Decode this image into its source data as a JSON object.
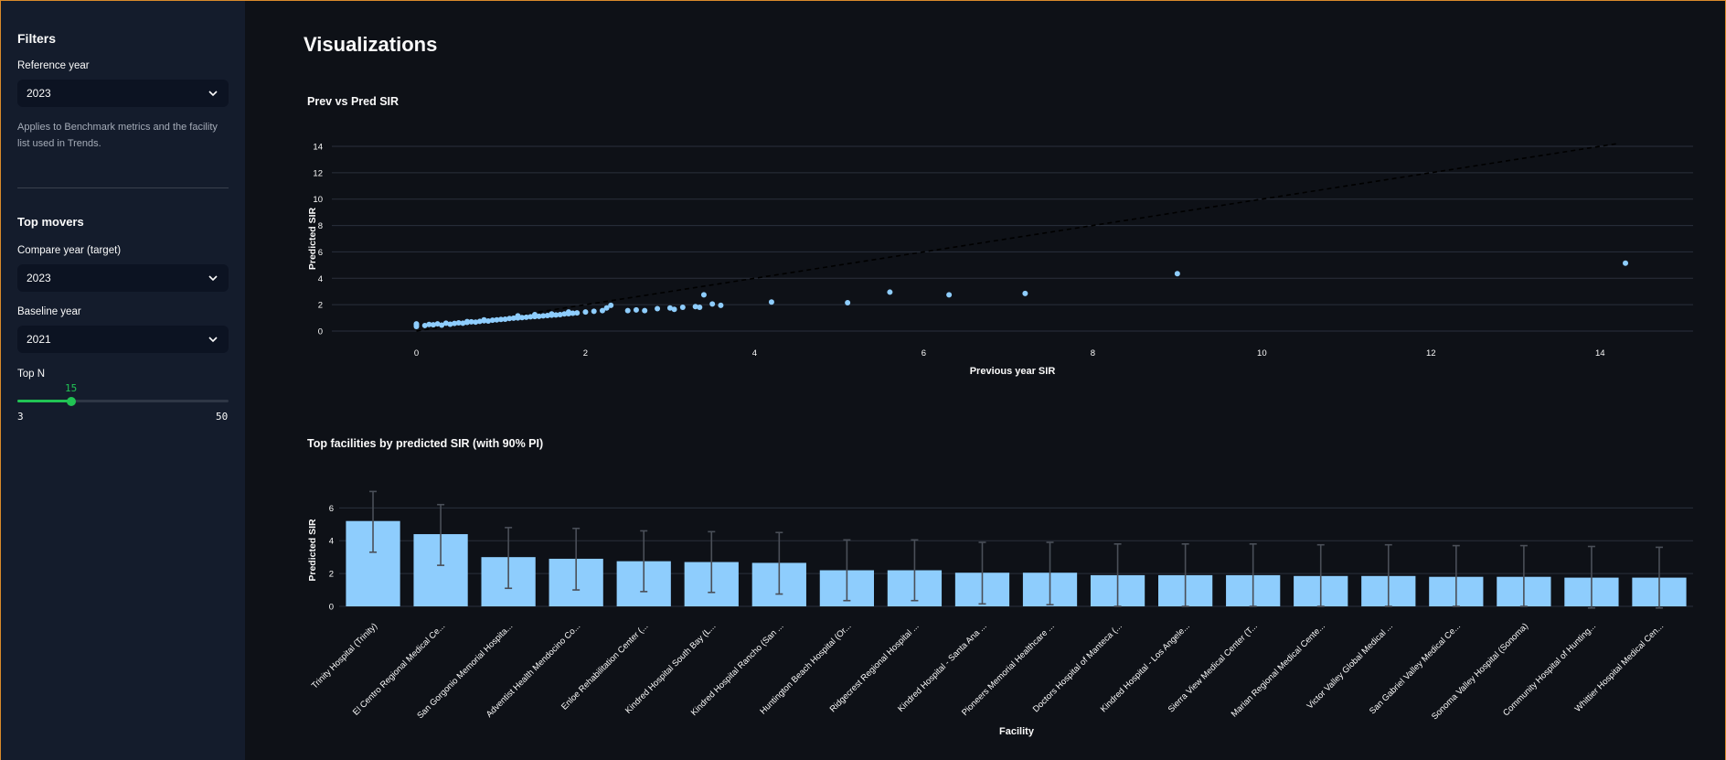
{
  "sidebar": {
    "filters_heading": "Filters",
    "reference_year_label": "Reference year",
    "reference_year_value": "2023",
    "note": "Applies to Benchmark metrics and the facility list used in Trends.",
    "top_movers_heading": "Top movers",
    "compare_year_label": "Compare year (target)",
    "compare_year_value": "2023",
    "baseline_year_label": "Baseline year",
    "baseline_year_value": "2021",
    "top_n_label": "Top N",
    "top_n_value": 15,
    "top_n_min": 3,
    "top_n_max": 50
  },
  "main": {
    "title": "Visualizations"
  },
  "colors": {
    "accent": "#21c354",
    "bar": "#8ecdfd",
    "point": "#8ecdfd",
    "background": "#0e1117",
    "sidebar": "#141c2c"
  },
  "icons": [
    "chevron-down-icon"
  ],
  "chart_data": [
    {
      "type": "scatter",
      "title": "Prev vs Pred SIR",
      "xlabel": "Previous year SIR",
      "ylabel": "Predicted SIR",
      "xlim": [
        -1,
        15.1
      ],
      "ylim": [
        0,
        14
      ],
      "xticks": [
        0,
        2,
        4,
        6,
        8,
        10,
        12,
        14
      ],
      "yticks": [
        0,
        2,
        4,
        6,
        8,
        10,
        12,
        14
      ],
      "grid": true,
      "reference_line": {
        "style": "dashed",
        "from": [
          0,
          0
        ],
        "to": [
          14.2,
          14.2
        ]
      },
      "points": [
        [
          0.0,
          0.35
        ],
        [
          0.0,
          0.45
        ],
        [
          0.0,
          0.55
        ],
        [
          0.1,
          0.42
        ],
        [
          0.15,
          0.5
        ],
        [
          0.2,
          0.48
        ],
        [
          0.25,
          0.55
        ],
        [
          0.3,
          0.45
        ],
        [
          0.35,
          0.6
        ],
        [
          0.4,
          0.52
        ],
        [
          0.45,
          0.58
        ],
        [
          0.5,
          0.62
        ],
        [
          0.55,
          0.6
        ],
        [
          0.6,
          0.66
        ],
        [
          0.65,
          0.7
        ],
        [
          0.7,
          0.68
        ],
        [
          0.75,
          0.74
        ],
        [
          0.8,
          0.78
        ],
        [
          0.85,
          0.76
        ],
        [
          0.9,
          0.82
        ],
        [
          0.95,
          0.85
        ],
        [
          1.0,
          0.88
        ],
        [
          1.05,
          0.9
        ],
        [
          1.1,
          0.95
        ],
        [
          1.15,
          0.98
        ],
        [
          1.2,
          1.0
        ],
        [
          1.25,
          1.02
        ],
        [
          1.3,
          1.05
        ],
        [
          1.35,
          1.08
        ],
        [
          1.4,
          1.1
        ],
        [
          1.45,
          1.12
        ],
        [
          1.5,
          1.15
        ],
        [
          1.55,
          1.18
        ],
        [
          1.6,
          1.2
        ],
        [
          1.65,
          1.22
        ],
        [
          1.7,
          1.25
        ],
        [
          1.75,
          1.3
        ],
        [
          1.8,
          1.32
        ],
        [
          1.85,
          1.35
        ],
        [
          1.9,
          1.38
        ],
        [
          1.2,
          1.15
        ],
        [
          1.4,
          1.25
        ],
        [
          1.6,
          1.3
        ],
        [
          1.8,
          1.45
        ],
        [
          0.6,
          0.72
        ],
        [
          0.8,
          0.85
        ],
        [
          2.0,
          1.45
        ],
        [
          2.1,
          1.5
        ],
        [
          2.2,
          1.55
        ],
        [
          2.25,
          1.75
        ],
        [
          2.3,
          1.95
        ],
        [
          2.5,
          1.55
        ],
        [
          2.6,
          1.6
        ],
        [
          2.7,
          1.55
        ],
        [
          2.85,
          1.7
        ],
        [
          3.0,
          1.75
        ],
        [
          3.05,
          1.65
        ],
        [
          3.15,
          1.8
        ],
        [
          3.3,
          1.85
        ],
        [
          3.35,
          1.8
        ],
        [
          3.4,
          2.75
        ],
        [
          3.5,
          2.05
        ],
        [
          3.6,
          1.95
        ],
        [
          4.2,
          2.2
        ],
        [
          5.1,
          2.15
        ],
        [
          5.6,
          2.95
        ],
        [
          6.3,
          2.75
        ],
        [
          7.2,
          2.85
        ],
        [
          9.0,
          4.35
        ],
        [
          14.3,
          5.15
        ]
      ]
    },
    {
      "type": "bar",
      "title": "Top facilities by predicted SIR (with 90% PI)",
      "xlabel": "Facility",
      "ylabel": "Predicted SIR",
      "ylim": [
        0,
        7.3
      ],
      "yticks": [
        0,
        2,
        4,
        6
      ],
      "grid": true,
      "categories": [
        "Trinity Hospital (Trinity)",
        "El Centro Regional Medical Ce...",
        "San Gorgonio Memorial Hospita...",
        "Adventist Health Mendocino Co...",
        "Enloe Rehabilitation Center (...",
        "Kindred Hospital South Bay (L...",
        "Kindred Hospital Rancho (San ...",
        "Huntington Beach Hospital (Or...",
        "Ridgecrest Regional Hospital ...",
        "Kindred Hospital - Santa Ana ...",
        "Pioneers Memorial Healthcare ...",
        "Doctors Hospital of Manteca (...",
        "Kindred Hospital - Los Angele...",
        "Sierra View Medical Center (T...",
        "Marian Regional Medical Cente...",
        "Victor Valley Global Medical ...",
        "San Gabriel Valley Medical Ce...",
        "Sonoma Valley Hospital (Sonoma)",
        "Community Hospital of Hunting...",
        "Whittier Hospital Medical Cen..."
      ],
      "values": [
        5.2,
        4.4,
        3.0,
        2.9,
        2.75,
        2.7,
        2.65,
        2.2,
        2.2,
        2.05,
        2.05,
        1.9,
        1.9,
        1.9,
        1.85,
        1.85,
        1.8,
        1.8,
        1.75,
        1.75
      ],
      "lower": [
        3.3,
        2.5,
        1.1,
        1.0,
        0.9,
        0.85,
        0.75,
        0.35,
        0.35,
        0.15,
        0.1,
        0.0,
        0.0,
        0.0,
        0.0,
        0.0,
        0.0,
        0.0,
        -0.1,
        -0.1
      ],
      "upper": [
        7.0,
        6.2,
        4.8,
        4.75,
        4.6,
        4.55,
        4.5,
        4.05,
        4.05,
        3.9,
        3.9,
        3.8,
        3.8,
        3.8,
        3.75,
        3.75,
        3.7,
        3.7,
        3.65,
        3.6
      ]
    }
  ]
}
